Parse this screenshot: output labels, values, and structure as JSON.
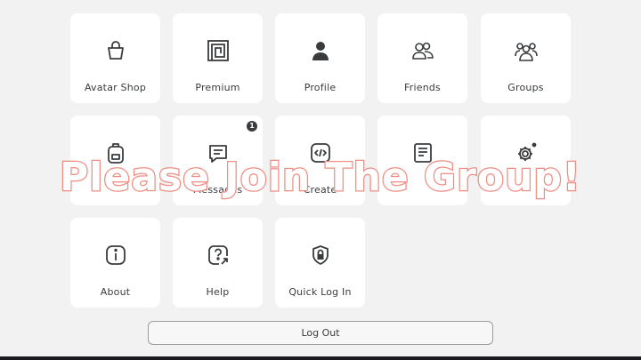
{
  "tiles": [
    {
      "label": "Avatar Shop",
      "icon": "shopping-bag-icon"
    },
    {
      "label": "Premium",
      "icon": "premium-icon"
    },
    {
      "label": "Profile",
      "icon": "person-icon"
    },
    {
      "label": "Friends",
      "icon": "friends-icon"
    },
    {
      "label": "Groups",
      "icon": "groups-icon"
    },
    {
      "label": "",
      "icon": "backpack-icon"
    },
    {
      "label": "Messages",
      "icon": "message-icon",
      "badge": "1"
    },
    {
      "label": "Create",
      "icon": "code-icon"
    },
    {
      "label": "",
      "icon": "blog-icon"
    },
    {
      "label": "",
      "icon": "gear-icon"
    },
    {
      "label": "About",
      "icon": "info-icon"
    },
    {
      "label": "Help",
      "icon": "help-icon"
    },
    {
      "label": "Quick Log In",
      "icon": "lock-shield-icon"
    }
  ],
  "logout_label": "Log Out",
  "overlay_text": "Please Join The Group!",
  "colors": {
    "overlay_outline": "#ee8f86",
    "tile_bg": "#ffffff",
    "page_bg": "#f2f2f3"
  }
}
